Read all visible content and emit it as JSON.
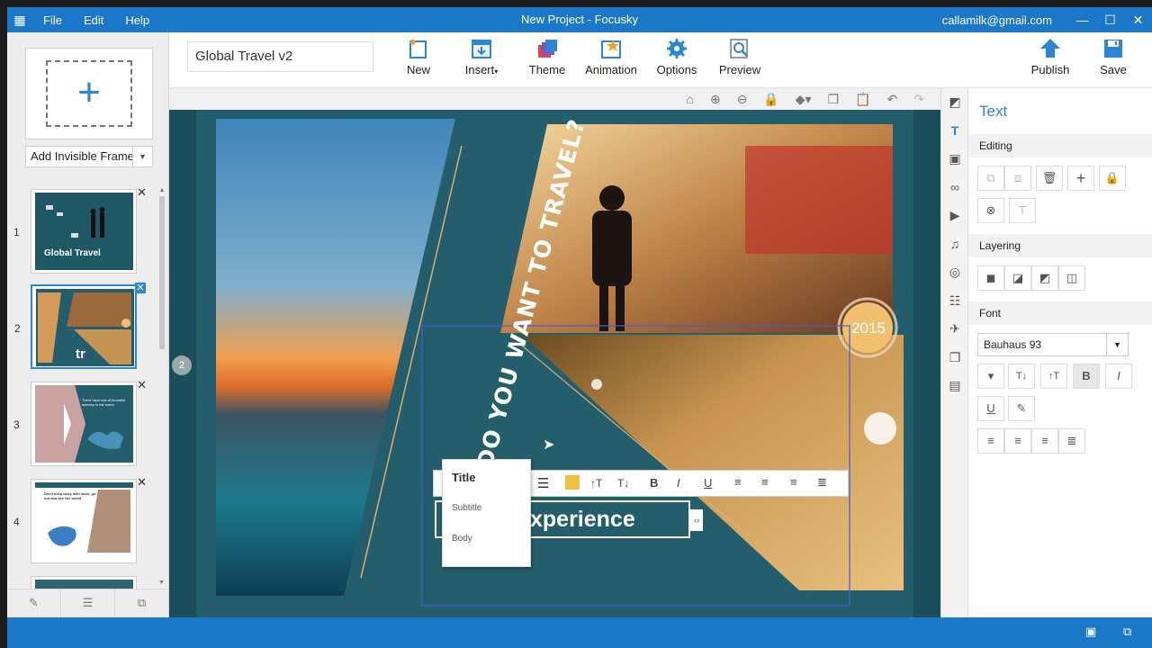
{
  "window": {
    "title": "New Project - Focusky",
    "account": "callamilk@gmail.com",
    "menu": [
      "File",
      "Edit",
      "Help"
    ]
  },
  "toolbar": {
    "project_name": "Global Travel v2",
    "buttons": [
      {
        "label": "New",
        "icon": "new-frame-icon"
      },
      {
        "label": "Insert",
        "icon": "insert-icon"
      },
      {
        "label": "Theme",
        "icon": "theme-icon"
      },
      {
        "label": "Animation",
        "icon": "animation-icon"
      },
      {
        "label": "Options",
        "icon": "gear-icon"
      },
      {
        "label": "Preview",
        "icon": "preview-icon"
      }
    ],
    "publish_label": "Publish",
    "save_label": "Save"
  },
  "left_panel": {
    "add_frame_dropdown": "Add Invisible Frame",
    "slides": [
      {
        "number": "1",
        "text": "Global Travel"
      },
      {
        "number": "2",
        "text": "tr"
      },
      {
        "number": "3",
        "text": "There have lots of beautiful scenery in the world"
      },
      {
        "number": "4",
        "text": "Don't keep busy with work, go out and see the world"
      }
    ]
  },
  "stage": {
    "frame_badge": "2",
    "headline": "WHERE DO YOU WANT TO TRAVEL?",
    "year_badge": "2015",
    "editing_text": "xperience",
    "style_menu": [
      "Title",
      "Subtitle",
      "Body"
    ]
  },
  "properties": {
    "title": "Text",
    "editing_label": "Editing",
    "layering_label": "Layering",
    "font_label": "Font",
    "font_value": "Bauhaus 93"
  },
  "colors": {
    "accent": "#1b78c9",
    "stage_bg": "#245e6c",
    "badge": "#f0c070"
  }
}
